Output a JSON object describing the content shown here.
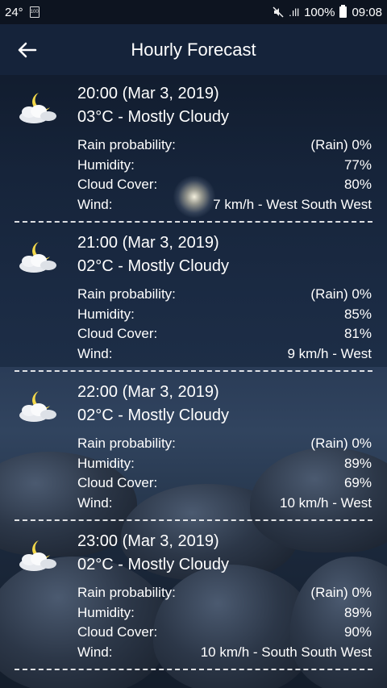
{
  "status_bar": {
    "temp": "24°",
    "signal": ".ıll",
    "battery": "100%",
    "time": "09:08"
  },
  "header": {
    "title": "Hourly Forecast"
  },
  "labels": {
    "rain": "Rain probability:",
    "humidity": "Humidity:",
    "cloud": "Cloud Cover:",
    "wind": "Wind:"
  },
  "forecast": [
    {
      "time": "20:00 (Mar 3, 2019)",
      "condition": "03°C - Mostly Cloudy",
      "rain": "(Rain) 0%",
      "humidity": "77%",
      "cloud": "80%",
      "wind": "7 km/h - West South West"
    },
    {
      "time": "21:00 (Mar 3, 2019)",
      "condition": "02°C - Mostly Cloudy",
      "rain": "(Rain) 0%",
      "humidity": "85%",
      "cloud": "81%",
      "wind": "9 km/h - West"
    },
    {
      "time": "22:00 (Mar 3, 2019)",
      "condition": "02°C - Mostly Cloudy",
      "rain": "(Rain) 0%",
      "humidity": "89%",
      "cloud": "69%",
      "wind": "10 km/h - West"
    },
    {
      "time": "23:00 (Mar 3, 2019)",
      "condition": "02°C - Mostly Cloudy",
      "rain": "(Rain) 0%",
      "humidity": "89%",
      "cloud": "90%",
      "wind": "10 km/h - South South West"
    }
  ]
}
